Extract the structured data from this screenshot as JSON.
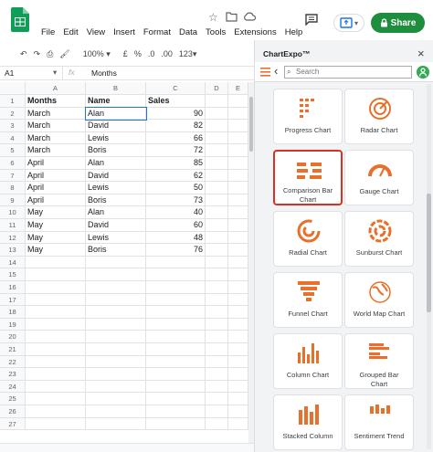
{
  "menu": [
    "File",
    "Edit",
    "View",
    "Insert",
    "Format",
    "Data",
    "Tools",
    "Extensions",
    "Help"
  ],
  "share_label": "Share",
  "toolbar": {
    "zoom": "100%",
    "currency": "£",
    "percent": "%",
    "dec_less": ".0",
    "dec_more": ".00",
    "format_more": "123"
  },
  "formula": {
    "cell_ref": "A1",
    "fx": "fx",
    "value": "Months"
  },
  "columns": [
    "A",
    "B",
    "C",
    "D",
    "E"
  ],
  "rows": [
    "1",
    "2",
    "3",
    "4",
    "5",
    "6",
    "7",
    "8",
    "9",
    "10",
    "11",
    "12",
    "13",
    "14",
    "15",
    "16",
    "17",
    "18",
    "19",
    "20",
    "21",
    "22",
    "23",
    "24",
    "25",
    "26",
    "27"
  ],
  "table": {
    "headers": [
      "Months",
      "Name",
      "Sales"
    ],
    "data": [
      [
        "March",
        "Alan",
        "90"
      ],
      [
        "March",
        "David",
        "82"
      ],
      [
        "March",
        "Lewis",
        "66"
      ],
      [
        "March",
        "Boris",
        "72"
      ],
      [
        "April",
        "Alan",
        "85"
      ],
      [
        "April",
        "David",
        "62"
      ],
      [
        "April",
        "Lewis",
        "50"
      ],
      [
        "April",
        "Boris",
        "73"
      ],
      [
        "May",
        "Alan",
        "40"
      ],
      [
        "May",
        "David",
        "60"
      ],
      [
        "May",
        "Lewis",
        "48"
      ],
      [
        "May",
        "Boris",
        "76"
      ]
    ]
  },
  "panel": {
    "title": "ChartExpo™",
    "close": "×",
    "search_placeholder": "Search",
    "charts": [
      {
        "label": "Progress Chart",
        "icon": "progress-chart-icon"
      },
      {
        "label": "Radar Chart",
        "icon": "radar-chart-icon"
      },
      {
        "label": "Comparison Bar Chart",
        "icon": "comparison-bar-chart-icon",
        "selected": true
      },
      {
        "label": "Gauge Chart",
        "icon": "gauge-chart-icon"
      },
      {
        "label": "Radial Chart",
        "icon": "radial-chart-icon"
      },
      {
        "label": "Sunburst Chart",
        "icon": "sunburst-chart-icon"
      },
      {
        "label": "Funnel Chart",
        "icon": "funnel-chart-icon"
      },
      {
        "label": "World Map Chart",
        "icon": "world-map-chart-icon"
      },
      {
        "label": "Column Chart",
        "icon": "column-chart-icon"
      },
      {
        "label": "Grouped Bar Chart",
        "icon": "grouped-bar-chart-icon"
      },
      {
        "label": "Stacked Column",
        "icon": "stacked-column-icon"
      },
      {
        "label": "Sentiment Trend",
        "icon": "sentiment-trend-icon"
      }
    ]
  },
  "colors": {
    "accent": "#e8702a",
    "selected_border": "#d93025",
    "share": "#1e8e3e",
    "sheets_green": "#0f9d58"
  }
}
